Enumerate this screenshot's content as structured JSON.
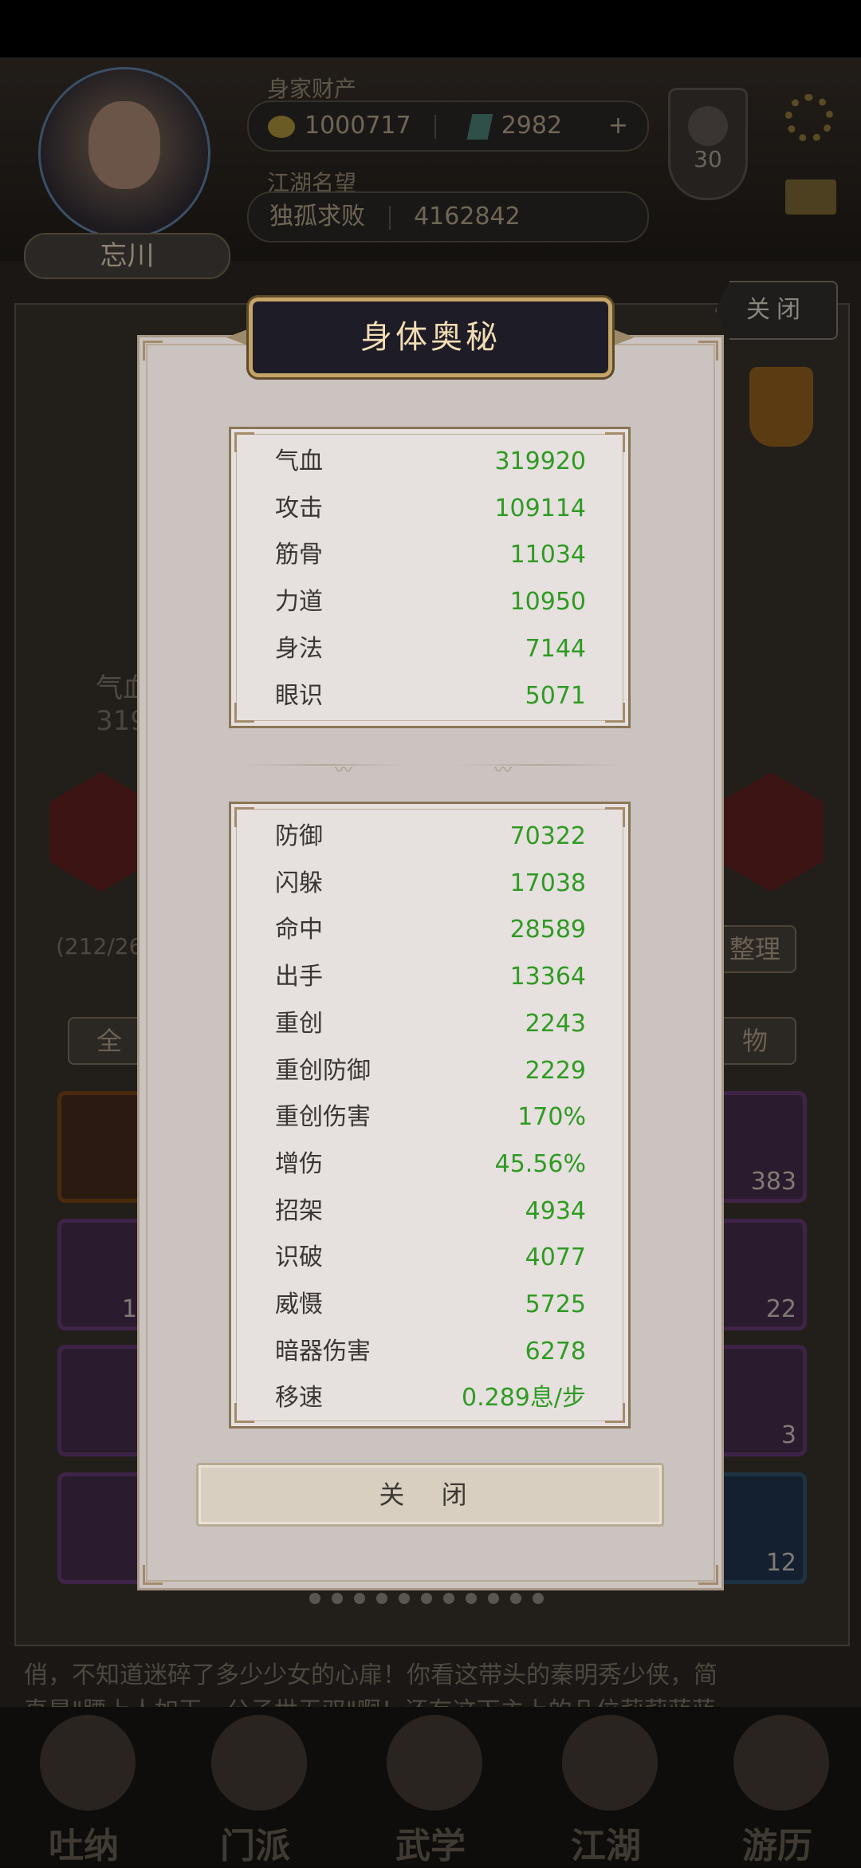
{
  "background": {
    "hud": {
      "assets_label": "身家财产",
      "gold_value": "1000717",
      "jade_value": "2982",
      "add_symbol": "+",
      "fame_label": "江湖名望",
      "fame_title": "独孤求败",
      "fame_value": "4162842",
      "level": "30"
    },
    "player_name": "忘川",
    "close_top_label": "关闭",
    "left_stat_label": "气血",
    "left_stat_value": "319",
    "inventory_count": "(212/26",
    "sort_button": "整理",
    "filter_all": "全",
    "filter_items": "物",
    "tile_counts": [
      "383",
      "19",
      "22",
      "3",
      "12"
    ],
    "story_line1": "俏，不知道迷碎了多少少女的心扉！你看这带头的秦明秀少侠，简",
    "story_line2": "直是\"腰上人如玉，公子世无双\"啊！还有这下主上的几位莉莉蓝蓝",
    "nav": [
      "吐纳",
      "门派",
      "武学",
      "江湖",
      "游历"
    ]
  },
  "modal": {
    "title": "身体奥秘",
    "primary_stats": [
      {
        "label": "气血",
        "value": "319920"
      },
      {
        "label": "攻击",
        "value": "109114"
      },
      {
        "label": "筋骨",
        "value": "11034"
      },
      {
        "label": "力道",
        "value": "10950"
      },
      {
        "label": "身法",
        "value": "7144"
      },
      {
        "label": "眼识",
        "value": "5071"
      }
    ],
    "secondary_stats": [
      {
        "label": "防御",
        "value": "70322"
      },
      {
        "label": "闪躲",
        "value": "17038"
      },
      {
        "label": "命中",
        "value": "28589"
      },
      {
        "label": "出手",
        "value": "13364"
      },
      {
        "label": "重创",
        "value": "2243"
      },
      {
        "label": "重创防御",
        "value": "2229"
      },
      {
        "label": "重创伤害",
        "value": "170%"
      },
      {
        "label": "增伤",
        "value": "45.56%"
      },
      {
        "label": "招架",
        "value": "4934"
      },
      {
        "label": "识破",
        "value": "4077"
      },
      {
        "label": "威慑",
        "value": "5725"
      },
      {
        "label": "暗器伤害",
        "value": "6278"
      },
      {
        "label": "移速",
        "value": "0.289息/步"
      }
    ],
    "close_label": "关 闭"
  },
  "colors": {
    "stat_value": "#2f9b22",
    "title_text": "#f2ddb3",
    "panel_border": "#8a7556"
  }
}
